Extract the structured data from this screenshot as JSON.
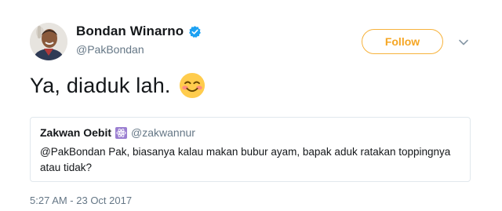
{
  "author": {
    "display_name": "Bondan Winarno",
    "handle": "@PakBondan",
    "avatar_icon": "avatar-photo",
    "verified_icon": "verified-badge-icon"
  },
  "actions": {
    "follow_label": "Follow",
    "menu_icon": "chevron-down-icon"
  },
  "tweet": {
    "text": "Ya, diaduk lah.",
    "emoji_icon": "smiling-face-with-smiling-eyes-emoji"
  },
  "quote": {
    "display_name": "Zakwan Oebit",
    "badge_icon": "atom-symbol-emoji",
    "handle": "@zakwannur",
    "text": "@PakBondan Pak, biasanya kalau makan bubur ayam, bapak aduk ratakan toppingnya atau tidak?"
  },
  "timestamp": "5:27 AM - 23 Oct 2017",
  "colors": {
    "follow_accent": "#f5a623",
    "verified_blue": "#1da1f2",
    "secondary_text": "#657786",
    "border": "#e1e8ed"
  }
}
